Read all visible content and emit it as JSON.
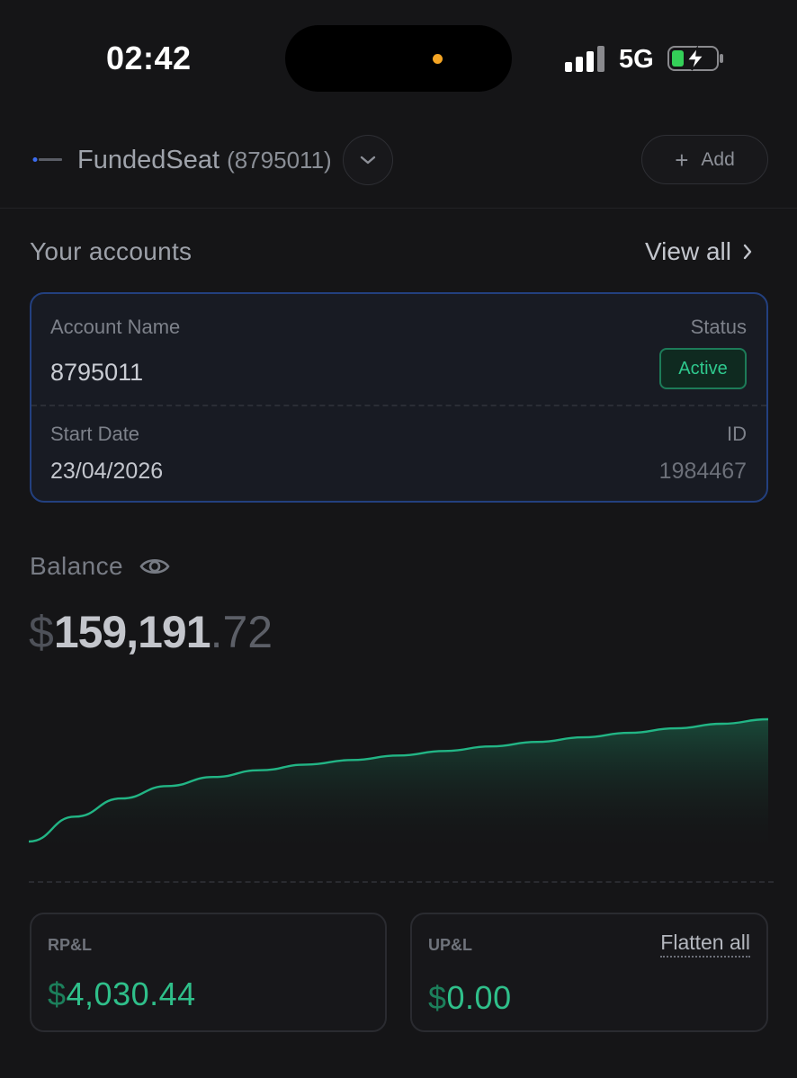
{
  "status_bar": {
    "time": "02:42",
    "network": "5G"
  },
  "header": {
    "brand": "FundedSeat",
    "account_number": "(8795011)",
    "add_label": "Add"
  },
  "accounts": {
    "title": "Your accounts",
    "view_all": "View all",
    "card": {
      "name_label": "Account Name",
      "name_value": "8795011",
      "status_label": "Status",
      "status_value": "Active",
      "start_label": "Start Date",
      "start_value": "23/04/2026",
      "id_label": "ID",
      "id_value": "1984467"
    }
  },
  "balance": {
    "label": "Balance",
    "currency": "$",
    "integer": "159,191",
    "decimal": ".72"
  },
  "pnl": {
    "rpl_label": "RP&L",
    "rpl_currency": "$",
    "rpl_value": "4,030.44",
    "upl_label": "UP&L",
    "upl_currency": "$",
    "upl_value": "0.00",
    "flatten_label": "Flatten all"
  },
  "colors": {
    "accent_green": "#2fc98e",
    "card_border_blue": "#23407f",
    "chart_line": "#22b585"
  },
  "chart_data": {
    "type": "area",
    "x": [
      0,
      1,
      2,
      3,
      4,
      5,
      6,
      7,
      8,
      9,
      10,
      11,
      12,
      13,
      14,
      15,
      16
    ],
    "values": [
      0,
      22,
      38,
      49,
      57,
      63,
      68,
      72,
      76,
      80,
      84,
      88,
      92,
      96,
      100,
      104,
      108
    ]
  }
}
